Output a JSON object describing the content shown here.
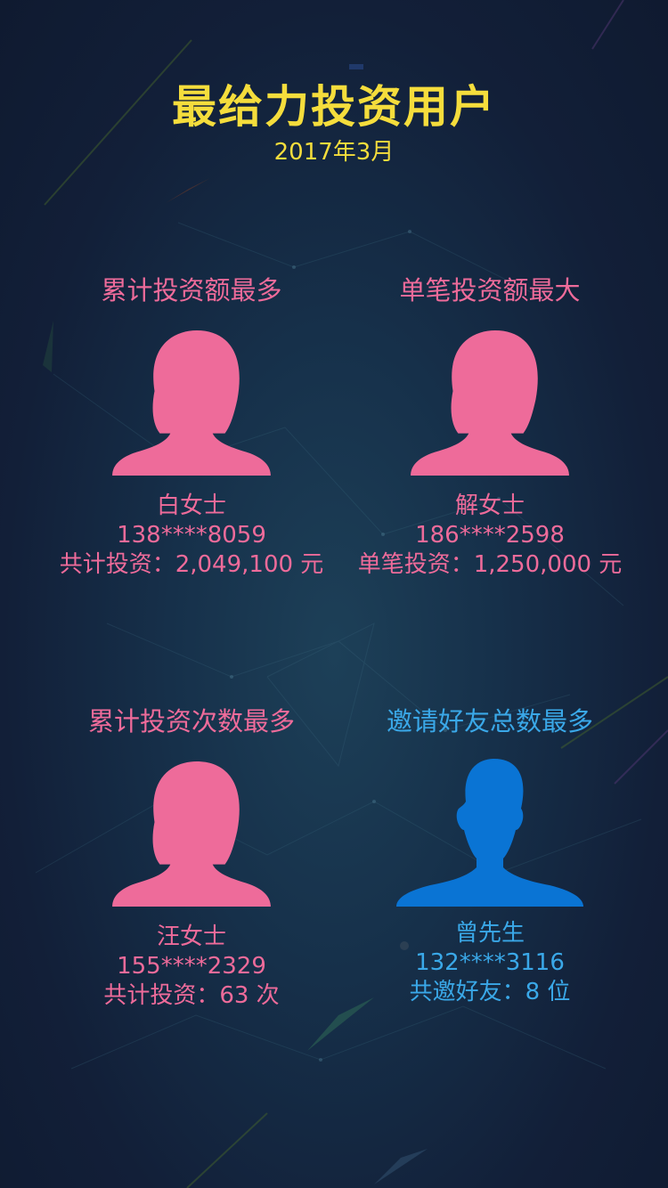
{
  "header": {
    "title": "最给力投资用户",
    "date": "2017年3月"
  },
  "colors": {
    "title": "#f5dd3c",
    "female": "#ee6b9a",
    "male": "#0a74d4",
    "male_text": "#3aa8e8"
  },
  "cards": [
    {
      "heading": "累计投资额最多",
      "avatar": "female-avatar-icon",
      "name": "白女士",
      "phone": "138****8059",
      "stat": "共计投资：2,049,100 元"
    },
    {
      "heading": "单笔投资额最大",
      "avatar": "female-avatar-icon",
      "name": "解女士",
      "phone": "186****2598",
      "stat": "单笔投资：1,250,000 元"
    },
    {
      "heading": "累计投资次数最多",
      "avatar": "female-avatar-icon",
      "name": "汪女士",
      "phone": "155****2329",
      "stat": "共计投资：63 次"
    },
    {
      "heading": "邀请好友总数最多",
      "avatar": "male-avatar-icon",
      "name": "曾先生",
      "phone": "132****3116",
      "stat": "共邀好友：8 位"
    }
  ]
}
